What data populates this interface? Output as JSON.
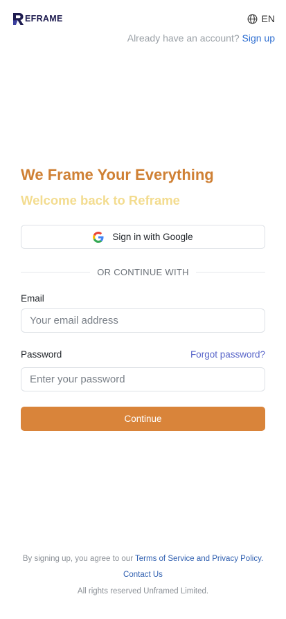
{
  "header": {
    "logo_text": "EFRAME",
    "language": "EN",
    "account_prompt": "Already have an account?",
    "signup_link": "Sign up"
  },
  "hero": {
    "headline": "We Frame Your Everything",
    "subheadline": "Welcome back to Reframe"
  },
  "auth": {
    "google_button": "Sign in with Google",
    "divider": "OR CONTINUE WITH",
    "email_label": "Email",
    "email_placeholder": "Your email address",
    "password_label": "Password",
    "password_placeholder": "Enter your password",
    "forgot_link": "Forgot password?",
    "continue_button": "Continue"
  },
  "footer": {
    "terms_prefix": "By signing up, you agree to our",
    "terms_link": "Terms of Service and Privacy Policy.",
    "contact_link": "Contact Us",
    "rights": "All rights reserved Unframed Limited."
  },
  "icons": {
    "logo": "reframe-logo-icon",
    "language": "globe-icon",
    "google": "google-icon"
  },
  "colors": {
    "brand_orange": "#d9843a",
    "headline": "#cf8034",
    "subheadline": "#f3dc8f",
    "link_blue": "#2f6fd1",
    "forgot_link": "#5865c9"
  }
}
